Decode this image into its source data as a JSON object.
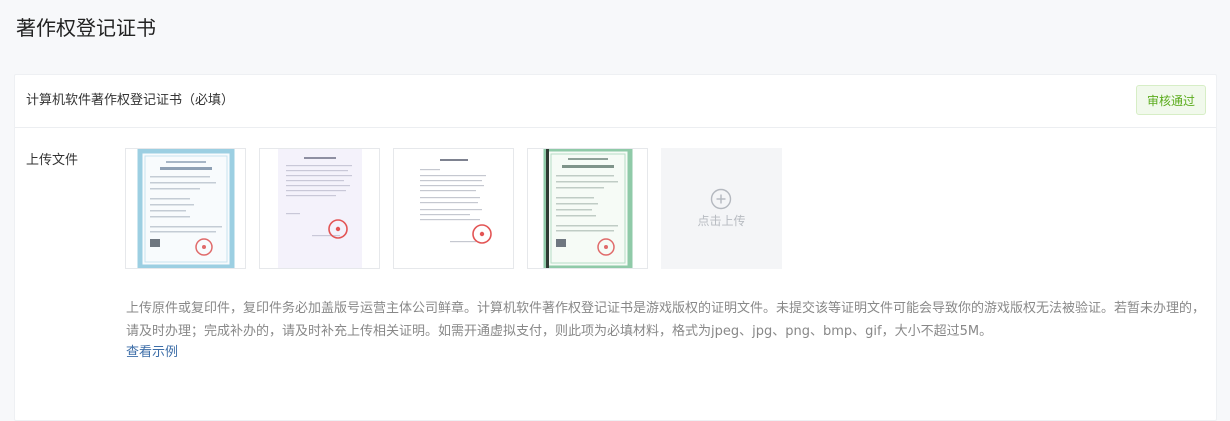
{
  "page": {
    "title": "著作权登记证书"
  },
  "card": {
    "title": "计算机软件著作权登记证书（必填）",
    "status": "审核通过",
    "status_color": "#5cac1e"
  },
  "upload": {
    "label": "上传文件",
    "upload_text": "点击上传",
    "thumbnails": [
      {
        "name": "certificate-image-1",
        "kind": "blue-border-certificate"
      },
      {
        "name": "certificate-image-2",
        "kind": "plain-document-with-seal"
      },
      {
        "name": "certificate-image-3",
        "kind": "plain-document-with-seal"
      },
      {
        "name": "certificate-image-4",
        "kind": "green-border-certificate"
      }
    ]
  },
  "hint": {
    "text": "上传原件或复印件，复印件务必加盖版号运营主体公司鲜章。计算机软件著作权登记证书是游戏版权的证明文件。未提交该等证明文件可能会导致你的游戏版权无法被验证。若暂未办理的，请及时办理；完成补办的，请及时补充上传相关证明。如需开通虚拟支付，则此项为必填材料，格式为jpeg、jpg、png、bmp、gif，大小不超过5M。",
    "example_link": "查看示例"
  },
  "colors": {
    "accent_link": "#3d6ea8",
    "success": "#5cac1e"
  }
}
